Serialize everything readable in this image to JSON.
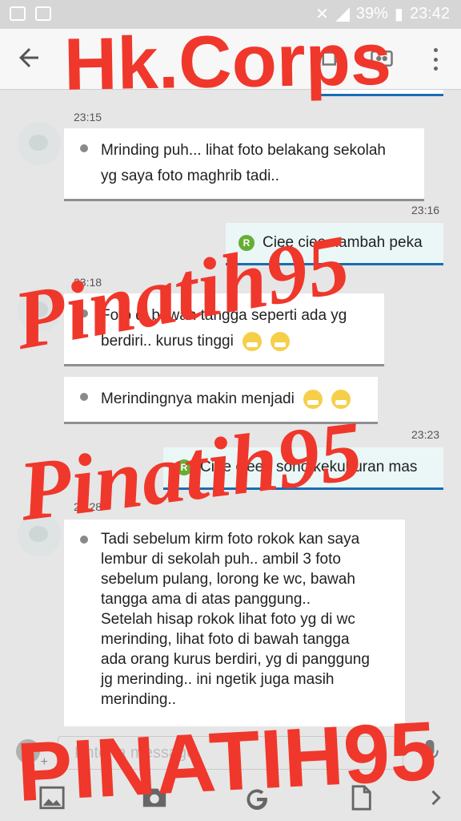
{
  "status_bar": {
    "battery": "39%",
    "time": "23:42"
  },
  "app_bar": {
    "back_icon": "arrow-left-icon",
    "video_icon": "video-camera-icon",
    "group_icon": "group-icon",
    "menu_icon": "more-vert-icon"
  },
  "messages": [
    {
      "time": "23:15",
      "text_lines": [
        "Mrinding puh... lihat foto belakang sekolah",
        "yg saya foto maghrib tadi.."
      ]
    },
    {
      "time": "23:16",
      "text": "Ciee ciee nambah peka",
      "badge": "R"
    },
    {
      "time": "23:18",
      "text_lines": [
        "Foto di bawah tangga seperti ada yg",
        "berdiri.. kurus tinggi"
      ]
    },
    {
      "text": "Merindingnya makin menjadi"
    },
    {
      "time": "23:23",
      "text": "Ciee cieee sono kekuburan mas",
      "badge": "R"
    },
    {
      "time": "23:28",
      "text_lines": [
        "Tadi sebelum kirm foto rokok kan saya",
        "lembur di sekolah puh.. ambil 3 foto",
        "sebelum pulang, lorong ke wc, bawah",
        "tangga ama di atas panggung..",
        "Setelah hisap rokok lihat foto yg di wc",
        "merinding, lihat foto di bawah tangga",
        "ada orang kurus berdiri, yg di panggung",
        "jg merinding.. ini ngetik juga masih",
        "merinding.."
      ]
    }
  ],
  "input": {
    "placeholder": "Enter a message"
  },
  "toolbar": [
    "image-icon",
    "camera-icon",
    "google-icon",
    "document-icon",
    "chevron-right-icon"
  ],
  "watermarks": [
    "Hk.Corps",
    "Pinatih95",
    "Pinatih95",
    "PINATIH95"
  ],
  "colors": {
    "watermark": "#f0372b",
    "outgoing_border": "#1a6cb3",
    "badge_green": "#65ad35",
    "outgoing_bg": "#eaf7f6"
  }
}
